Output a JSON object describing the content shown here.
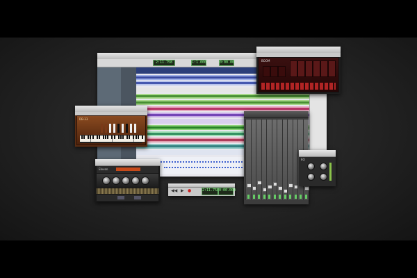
{
  "screen": {
    "description_colors": {
      "background": "#000000",
      "panel_bg": "#2a2a2a"
    }
  },
  "edit_window": {
    "counter_main": "2:11.758",
    "counter_sub": "1:1.000",
    "counter_aux": "0:00.00"
  },
  "mix_window": {
    "channel_count": 12
  },
  "transport": {
    "counter": "2:11.758",
    "counter_sub": "0:00.000"
  },
  "drum_plugin": {
    "name": "BOOM"
  },
  "organ_plugin": {
    "name": "DB-33"
  },
  "amp_plugin": {
    "name": "Eleven"
  },
  "eq_plugin": {
    "name": "EQ"
  },
  "icons": [
    "drum-machine-icon",
    "organ-icon",
    "amp-icon",
    "mixer-icon",
    "eq-icon"
  ]
}
